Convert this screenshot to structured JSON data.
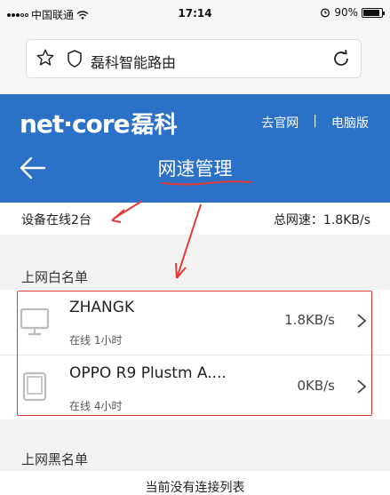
{
  "status_bar": {
    "carrier": "中国联通",
    "time": "17:14",
    "battery": "90%",
    "battery_level": 0.9
  },
  "browser": {
    "address_text": "磊科智能路由",
    "icons": [
      "star-icon",
      "shield-icon",
      "reload-icon"
    ]
  },
  "header": {
    "logo_text": "net·core",
    "logo_cn": "磊科",
    "links": [
      "去官网",
      "电脑版"
    ],
    "separator": "|",
    "title": "网速管理"
  },
  "summary": {
    "online": "设备在线2台",
    "total_speed": "总网速：1.8KB/s"
  },
  "whitelist": {
    "title": "上网白名单",
    "devices": [
      {
        "name": "ZHANGK",
        "status": "在线 1小时",
        "speed": "1.8KB/s",
        "icon": "desktop-icon"
      },
      {
        "name": "OPPO R9 Plustm A....",
        "status": "在线 4小时",
        "speed": "0KB/s",
        "icon": "tablet-icon"
      }
    ]
  },
  "blacklist": {
    "title": "上网黑名单",
    "empty_text": "当前没有连接列表"
  },
  "colors": {
    "header_blue": "#2b71c8",
    "annotation_red": "#e53935",
    "section_bg": "#f2f2f2"
  }
}
